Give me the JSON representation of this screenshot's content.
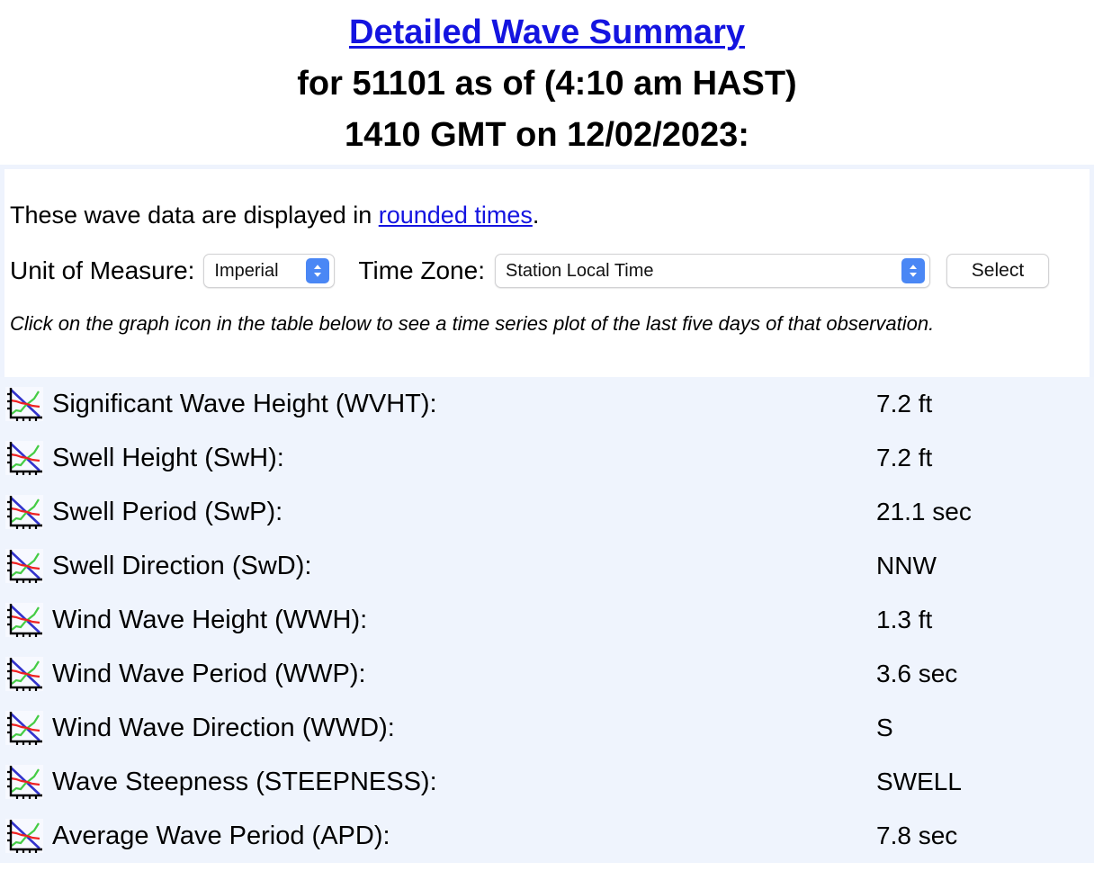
{
  "header": {
    "title_link": "Detailed Wave Summary",
    "line2": "for 51101 as of (4:10 am HAST)",
    "line3": "1410 GMT on 12/02/2023:"
  },
  "form": {
    "note_prefix": "These wave data are displayed in ",
    "note_link": "rounded times",
    "note_suffix": ".",
    "unit_label": "Unit of Measure:",
    "unit_value": "Imperial",
    "timezone_label": "Time Zone:",
    "timezone_value": "Station Local Time",
    "select_button": "Select",
    "hint": "Click on the graph icon in the table below to see a time series plot of the last five days of that observation."
  },
  "colors": {
    "link_blue": "#1414e0",
    "panel_border": "#eef3fd",
    "table_bg": "#eff4fd",
    "stepper_blue": "#4a87f5",
    "icon_blue": "#3333cc",
    "icon_green": "#44cc44",
    "icon_red": "#ee2222",
    "icon_axis": "#000000"
  },
  "table": {
    "icon_name": "graph-icon",
    "rows": [
      {
        "label": "Significant Wave Height (WVHT):",
        "value": "7.2 ft"
      },
      {
        "label": "Swell Height (SwH):",
        "value": "7.2 ft"
      },
      {
        "label": "Swell Period (SwP):",
        "value": "21.1 sec"
      },
      {
        "label": "Swell Direction (SwD):",
        "value": "NNW"
      },
      {
        "label": "Wind Wave Height (WWH):",
        "value": "1.3 ft"
      },
      {
        "label": "Wind Wave Period (WWP):",
        "value": "3.6 sec"
      },
      {
        "label": "Wind Wave Direction (WWD):",
        "value": "S"
      },
      {
        "label": "Wave Steepness (STEEPNESS):",
        "value": "SWELL"
      },
      {
        "label": "Average Wave Period (APD):",
        "value": "7.8 sec"
      }
    ]
  }
}
